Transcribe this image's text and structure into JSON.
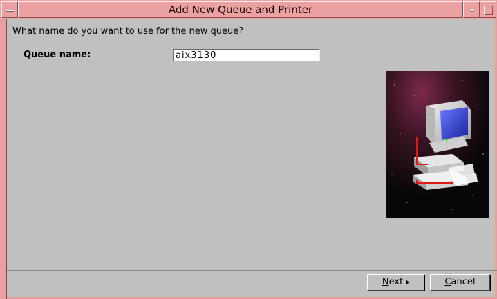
{
  "window": {
    "title": "Add New Queue and Printer"
  },
  "content": {
    "prompt": "What name do you want to use for the new queue?",
    "queue_name_label": "Queue name:",
    "queue_name_value": "aix3130"
  },
  "buttons": {
    "next_mnemonic": "N",
    "next_rest": "ext",
    "cancel_mnemonic": "C",
    "cancel_rest": "ancel"
  },
  "icons": {
    "window_menu": "window-menu-icon",
    "minimize": "minimize-icon",
    "maximize": "maximize-icon",
    "next_arrow": "right-arrow-icon",
    "illustration": "printer-computer-illustration"
  },
  "colors": {
    "titlebar": "#eba1a1",
    "window_bg": "#c0c0c0"
  }
}
